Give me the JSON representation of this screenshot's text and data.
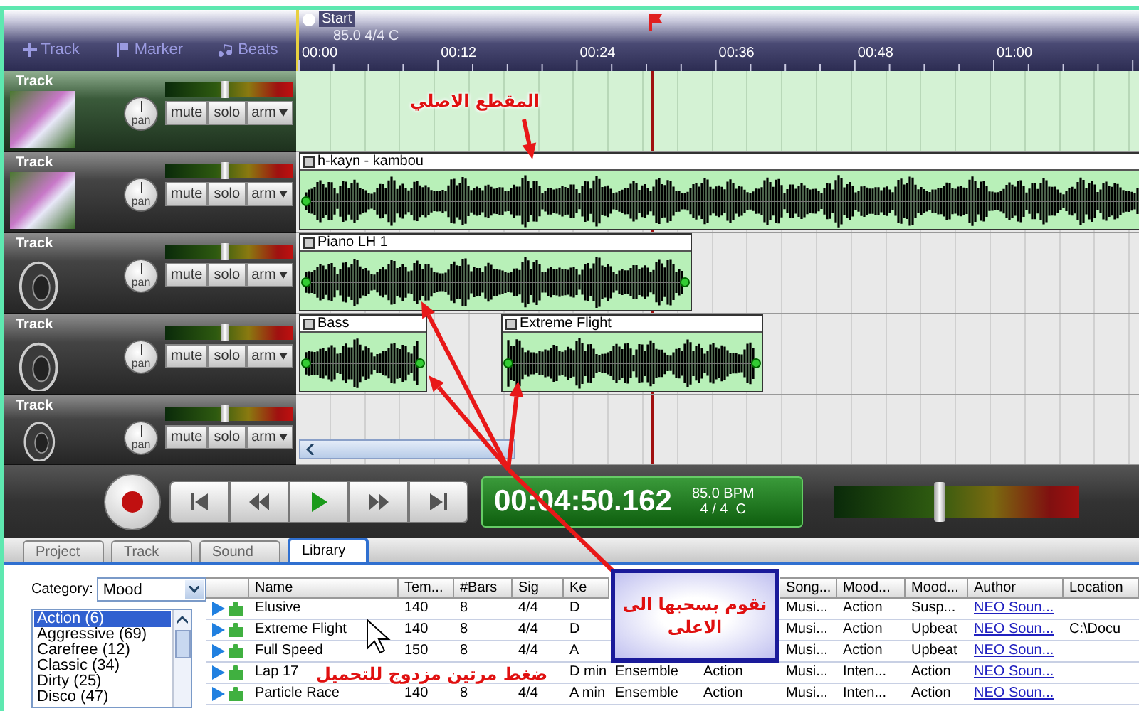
{
  "toolbar": [
    {
      "kind": "add",
      "label": "Track"
    },
    {
      "kind": "marker",
      "label": "Marker"
    },
    {
      "kind": "beats",
      "label": "Beats"
    }
  ],
  "ruler": {
    "start_label": "Start",
    "tempo_label": "85.0 4/4 C",
    "ticks": [
      "00:00",
      "00:12",
      "00:24",
      "00:36",
      "00:48",
      "01:00"
    ]
  },
  "tracks": [
    {
      "name": "Track",
      "selected": true,
      "thumbnail": {
        "kind": "photo"
      },
      "pan": "pan",
      "volume": {
        "level": 0.47
      },
      "buttons": [
        "mute",
        "solo",
        "arm"
      ]
    },
    {
      "name": "Track",
      "selected": false,
      "thumbnail": {
        "kind": "photo"
      },
      "pan": "pan",
      "volume": {
        "level": 0.47
      },
      "buttons": [
        "mute",
        "solo",
        "arm"
      ],
      "clips": [
        {
          "title": "h-kayn - kambou"
        }
      ]
    },
    {
      "name": "Track",
      "selected": false,
      "thumbnail": {
        "kind": "speaker"
      },
      "pan": "pan",
      "volume": {
        "level": 0.47
      },
      "buttons": [
        "mute",
        "solo",
        "arm"
      ],
      "clips": [
        {
          "title": "Piano LH 1"
        }
      ]
    },
    {
      "name": "Track",
      "selected": false,
      "thumbnail": {
        "kind": "speaker"
      },
      "pan": "pan",
      "volume": {
        "level": 0.47
      },
      "buttons": [
        "mute",
        "solo",
        "arm"
      ],
      "clips": [
        {
          "title": "Bass"
        },
        {
          "title": "Extreme Flight"
        }
      ]
    },
    {
      "name": "Track",
      "selected": false,
      "thumbnail": {
        "kind": "speaker"
      },
      "pan": "pan",
      "volume": {
        "level": 0.47
      },
      "buttons": [
        "mute",
        "solo",
        "arm"
      ]
    }
  ],
  "transport": {
    "buttons": [
      {
        "kind": "record"
      },
      {
        "kind": "to_start"
      },
      {
        "kind": "rewind"
      },
      {
        "kind": "play"
      },
      {
        "kind": "forward"
      },
      {
        "kind": "to_end"
      }
    ],
    "time": "00:04:50.162",
    "tempo": "85.0 BPM",
    "signature": "4 / 4  C",
    "master": {
      "level": 0.43
    }
  },
  "tabs": [
    {
      "label": "Project",
      "selected": false
    },
    {
      "label": "Track",
      "selected": false
    },
    {
      "label": "Sound",
      "selected": false
    },
    {
      "label": "Library",
      "selected": true
    }
  ],
  "library": {
    "category_label": "Category:",
    "category": "Mood",
    "categories": [
      {
        "label": "Action (6)",
        "selected": true
      },
      {
        "label": "Aggressive (69)",
        "selected": false
      },
      {
        "label": "Carefree (12)",
        "selected": false
      },
      {
        "label": "Classic (34)",
        "selected": false
      },
      {
        "label": "Dirty (25)",
        "selected": false
      },
      {
        "label": "Disco (47)",
        "selected": false
      }
    ],
    "columns": [
      {
        "kind": "text",
        "label": "Name"
      },
      {
        "kind": "text",
        "label": "Tem..."
      },
      {
        "kind": "text",
        "label": "#Bars"
      },
      {
        "kind": "text",
        "label": "Sig"
      },
      {
        "kind": "text",
        "label": "Ke"
      },
      {
        "kind": "text"
      },
      {
        "kind": "text"
      },
      {
        "kind": "text",
        "label": "Song..."
      },
      {
        "kind": "text",
        "label": "Mood..."
      },
      {
        "kind": "text",
        "label": "Mood..."
      },
      {
        "kind": "link",
        "label": "Author"
      },
      {
        "kind": "text",
        "label": "Location"
      }
    ],
    "rows": [
      [
        "Elusive",
        "140",
        "8",
        "4/4",
        "D",
        null,
        null,
        "Musi...",
        "Action",
        "Susp...",
        "NEO Soun...",
        null
      ],
      [
        "Extreme Flight",
        "140",
        "8",
        "4/4",
        "D",
        null,
        null,
        "Musi...",
        "Action",
        "Upbeat",
        "NEO Soun...",
        "C:\\Docu"
      ],
      [
        "Full Speed",
        "150",
        "8",
        "4/4",
        "A",
        null,
        null,
        "Musi...",
        "Action",
        "Upbeat",
        "NEO Soun...",
        null
      ],
      [
        "Lap 17",
        null,
        null,
        null,
        "D min",
        "Ensemble",
        "Action",
        "Musi...",
        "Inten...",
        "Action",
        "NEO Soun...",
        null
      ],
      [
        "Particle Race",
        "140",
        "8",
        "4/4",
        "A min",
        "Ensemble",
        "Action",
        "Musi...",
        "Inten...",
        "Action",
        "NEO Soun...",
        null
      ]
    ]
  },
  "annotations": {
    "original_clip": "المقطع الاصلي",
    "callout": "نقوم بسحبها الى الاعلى",
    "double_click": "ضغط مرتين مزدوج للتحميل"
  }
}
